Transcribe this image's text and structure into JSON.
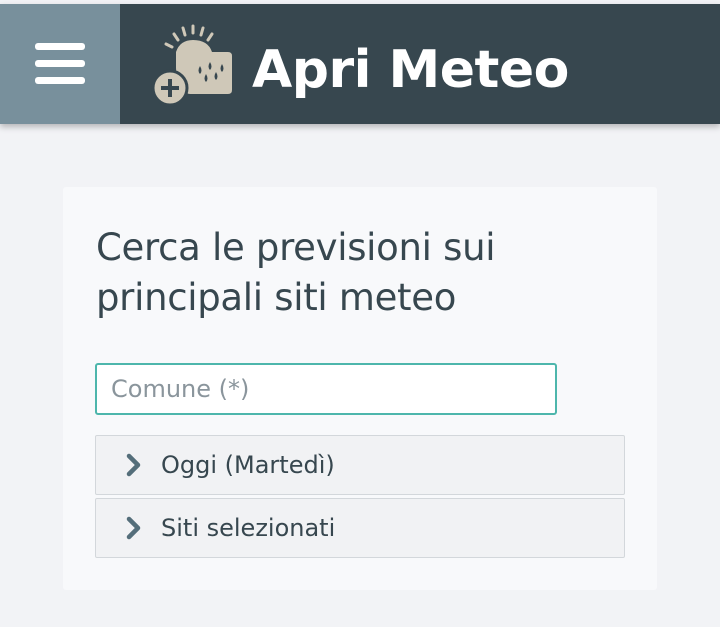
{
  "header": {
    "title": "Apri Meteo",
    "menu_icon": "hamburger-menu-icon",
    "logo_icon": "weather-logo-icon"
  },
  "main": {
    "heading": "Cerca le previsioni sui principali siti meteo",
    "search": {
      "placeholder": "Comune (*)",
      "value": ""
    },
    "sections": [
      {
        "label": "Oggi (Martedì)",
        "icon": "chevron-right-icon",
        "expanded": false
      },
      {
        "label": "Siti selezionati",
        "icon": "chevron-right-icon",
        "expanded": false
      }
    ]
  },
  "colors": {
    "header_bg": "#37474f",
    "menu_bg": "#78909c",
    "accent": "#4db6ac",
    "page_bg": "#f2f3f6"
  }
}
